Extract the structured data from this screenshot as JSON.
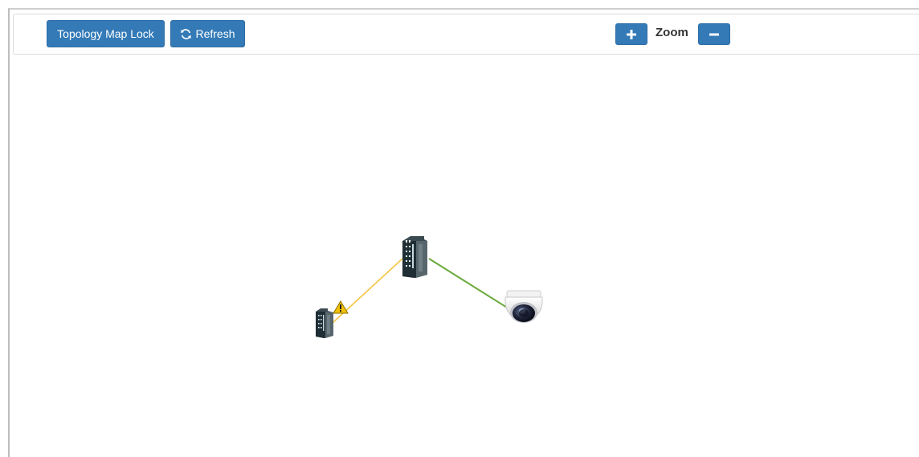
{
  "toolbar": {
    "lock_label": "Topology Map Lock",
    "refresh_label": "Refresh",
    "refresh_icon": "refresh-icon",
    "zoom_label": "Zoom",
    "zoom_in_icon": "plus-icon",
    "zoom_out_icon": "minus-icon"
  },
  "colors": {
    "button": "#337ab7",
    "link_warning": "#f5c542",
    "link_ok": "#6aaa3a",
    "warning_icon": "#f2c200"
  },
  "topology": {
    "nodes": [
      {
        "type": "industrial-switch",
        "icon": "switch-icon"
      },
      {
        "type": "industrial-switch",
        "icon": "switch-icon",
        "status": "warning"
      },
      {
        "type": "dome-camera",
        "icon": "camera-icon"
      }
    ],
    "links": [
      {
        "status": "warning",
        "color": "#f5c542"
      },
      {
        "status": "ok",
        "color": "#6aaa3a"
      }
    ]
  }
}
